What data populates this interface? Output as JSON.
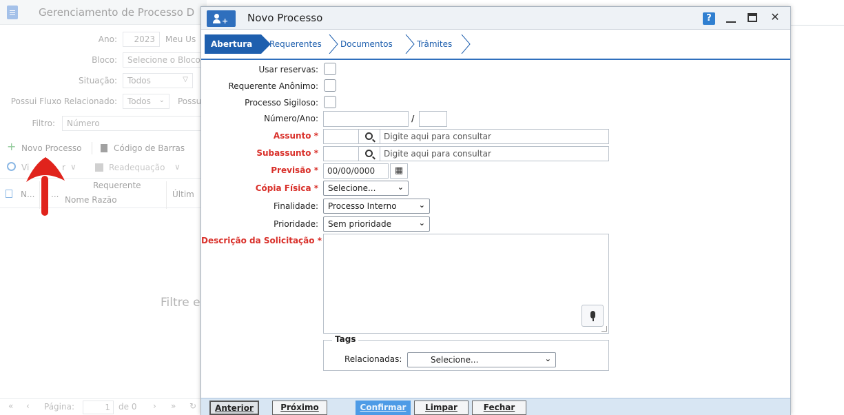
{
  "background": {
    "window_title": "Gerenciamento de Processo D",
    "filters": {
      "ano_label": "Ano:",
      "ano_value": "2023",
      "meu_label": "Meu Us",
      "bloco_label": "Bloco:",
      "bloco_placeholder": "Selecione o Bloco",
      "situacao_label": "Situação:",
      "situacao_value": "Todos",
      "fluxo_label": "Possui Fluxo Relacionado:",
      "fluxo_value": "Todos",
      "possui_label": "Possu",
      "filtro_label": "Filtro:",
      "filtro_value": "Número"
    },
    "toolbar": {
      "novo_processo": "Novo Processo",
      "codigo_barras": "Código de Barras",
      "visualizar": "Vi",
      "visualizar_tail": "r",
      "readequacao": "Readequação"
    },
    "grid": {
      "col_n": "N...",
      "col_dots": "...",
      "col_requerente": "Requerente",
      "col_nome_razao": "Nome Razão",
      "col_ultimo": "Últim"
    },
    "empty_text": "Filtre e",
    "pager": {
      "pagina_label": "Página:",
      "pagina_value": "1",
      "de_label": "de 0"
    }
  },
  "modal": {
    "title": "Novo Processo",
    "help_label": "?",
    "steps": [
      "Abertura",
      "Requerentes",
      "Documentos",
      "Trâmites"
    ],
    "form": {
      "usar_reservas": "Usar reservas:",
      "requerente_anonimo": "Requerente Anônimo:",
      "processo_sigiloso": "Processo Sigiloso:",
      "numero_ano": "Número/Ano:",
      "slash": "/",
      "assunto": "Assunto *",
      "assunto_placeholder": "Digite aqui para consultar",
      "subassunto": "Subassunto *",
      "subassunto_placeholder": "Digite aqui para consultar",
      "previsao": "Previsão *",
      "previsao_value": "00/00/0000",
      "copia_fisica": "Cópia Física *",
      "copia_fisica_value": "Selecione...",
      "finalidade": "Finalidade:",
      "finalidade_value": "Processo Interno",
      "prioridade": "Prioridade:",
      "prioridade_value": "Sem prioridade",
      "descricao": "Descrição da Solicitação *",
      "tags_legend": "Tags",
      "relacionadas_label": "Relacionadas:",
      "relacionadas_value": "Selecione..."
    },
    "footer": {
      "anterior": "Anterior",
      "proximo": "Próximo",
      "confirmar": "Confirmar",
      "limpar": "Limpar",
      "fechar": "Fechar"
    }
  },
  "colors": {
    "accent": "#1e5fae",
    "required": "#d9302a",
    "annotation_arrow": "#e0231c"
  }
}
